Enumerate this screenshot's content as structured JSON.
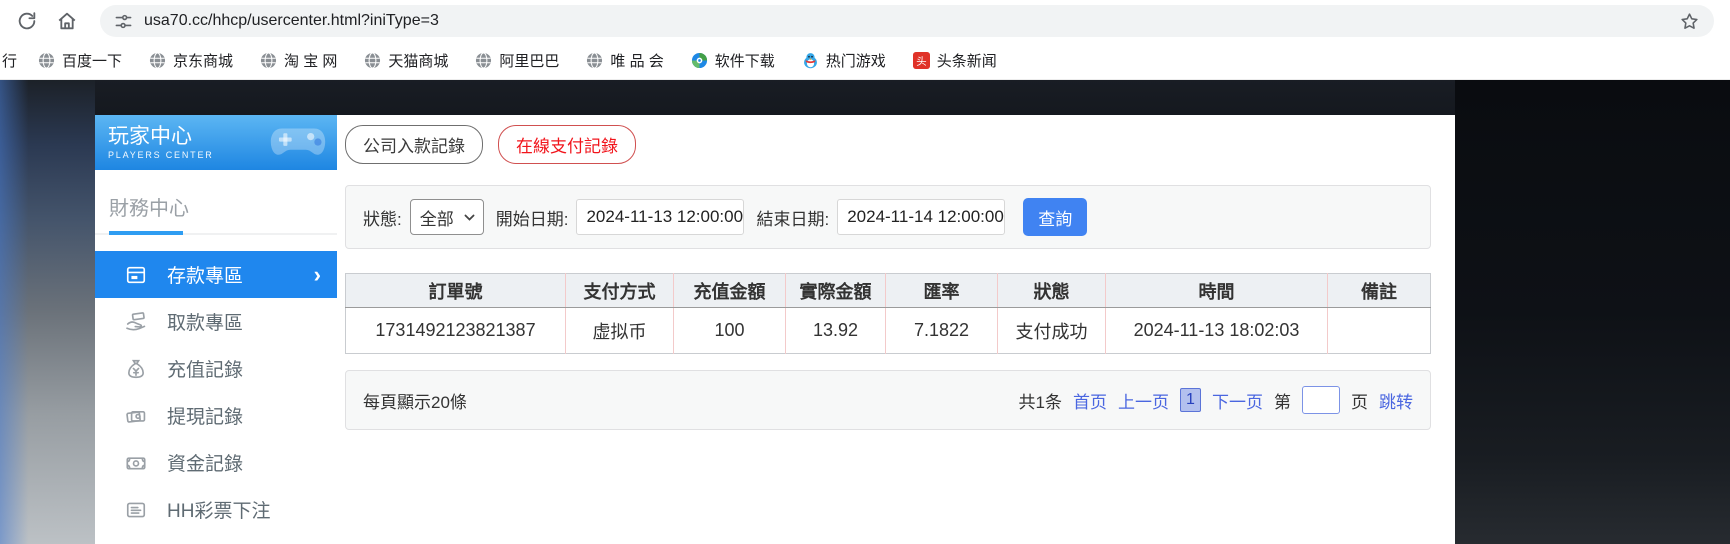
{
  "browser": {
    "url": "usa70.cc/hhcp/usercenter.html?iniType=3",
    "bookmarks": [
      {
        "key": "partial-left",
        "label": "行",
        "icon": "globe-icon",
        "partial": true
      },
      {
        "key": "baidu",
        "label": "百度一下",
        "icon": "globe-icon"
      },
      {
        "key": "jd",
        "label": "京东商城",
        "icon": "globe-icon"
      },
      {
        "key": "taobao",
        "label": "淘 宝 网",
        "icon": "globe-icon"
      },
      {
        "key": "tmall",
        "label": "天猫商城",
        "icon": "globe-icon"
      },
      {
        "key": "alibaba",
        "label": "阿里巴巴",
        "icon": "globe-icon"
      },
      {
        "key": "vip",
        "label": "唯 品 会",
        "icon": "globe-icon"
      },
      {
        "key": "software-download",
        "label": "软件下载",
        "icon": "pinwheel-icon"
      },
      {
        "key": "hot-games",
        "label": "热门游戏",
        "icon": "penguin-icon"
      },
      {
        "key": "toutiao-news",
        "label": "头条新闻",
        "icon": "toutiao-icon"
      }
    ]
  },
  "sidebar": {
    "title": "玩家中心",
    "subtitle": "PLAYERS CENTER",
    "section": "財務中心",
    "items": [
      {
        "key": "deposit-zone",
        "label": "存款專區",
        "icon": "deposit-machine-icon",
        "active": true
      },
      {
        "key": "withdraw-zone",
        "label": "取款專區",
        "icon": "hand-money-icon",
        "active": false
      },
      {
        "key": "recharge-records",
        "label": "充值記錄",
        "icon": "money-bag-icon",
        "active": false
      },
      {
        "key": "withdrawal-records",
        "label": "提現記錄",
        "icon": "cards-icon",
        "active": false
      },
      {
        "key": "fund-records",
        "label": "資金記錄",
        "icon": "banknote-icon",
        "active": false
      },
      {
        "key": "hh-lottery-bets",
        "label": "HH彩票下注",
        "icon": "list-form-icon",
        "active": false
      }
    ]
  },
  "tabs": [
    {
      "key": "company-deposit-records",
      "label": "公司入款記錄",
      "active": false
    },
    {
      "key": "online-payment-records",
      "label": "在線支付記錄",
      "active": true
    }
  ],
  "filters": {
    "status_label": "狀態:",
    "status_value": "全部",
    "start_label": "開始日期:",
    "start_value": "2024-11-13 12:00:00",
    "end_label": "結束日期:",
    "end_value": "2024-11-14 12:00:00",
    "search_label": "查詢"
  },
  "table": {
    "headers": [
      "訂單號",
      "支付方式",
      "充值金額",
      "實際金額",
      "匯率",
      "狀態",
      "時間",
      "備註"
    ],
    "rows": [
      [
        "1731492123821387",
        "虚拟币",
        "100",
        "13.92",
        "7.1822",
        "支付成功",
        "2024-11-13 18:02:03",
        ""
      ]
    ]
  },
  "pagination": {
    "page_size_text": "每頁顯示20條",
    "total_text": "共1条",
    "first": "首页",
    "prev": "上一页",
    "current": "1",
    "next": "下一页",
    "jump_prefix": "第",
    "jump_suffix": "页",
    "jump_action": "跳转"
  },
  "colors": {
    "sidebar_active_blue": "#1f87ee",
    "header_gradient_top": "#5cb6f3",
    "header_gradient_bottom": "#1e86e2",
    "tab_active_red": "#f1151c",
    "search_button_blue": "#4083f2",
    "link_blue": "#4a66e0",
    "table_divider_pink": "#f3caca"
  }
}
